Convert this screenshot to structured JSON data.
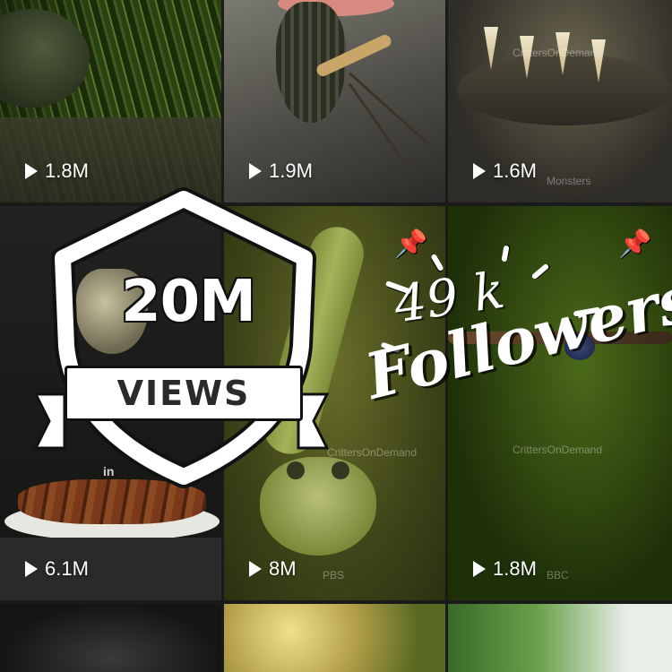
{
  "tiles": [
    {
      "views": "1.8M"
    },
    {
      "views": "1.9M"
    },
    {
      "views": "1.6M",
      "watermark": "Monsters"
    },
    {
      "views": "6.1M",
      "watermark": "in"
    },
    {
      "views": "8M",
      "watermark": "PBS"
    },
    {
      "views": "1.8M",
      "watermark": "CrittersOnDemand",
      "watermark2": "BBC"
    }
  ],
  "tile_watermarks": {
    "t2_top": "CrittersOnDemand",
    "t4_mid": "CrittersOnDemand"
  },
  "badge": {
    "count": "20M",
    "label": "VIEWS"
  },
  "followers": {
    "count": "49 k",
    "label": "Followers"
  },
  "colors": {
    "overlay_text": "#ffffff",
    "outline": "#111111"
  },
  "icons": [
    "play-icon",
    "shield-icon",
    "pushpin-icon"
  ]
}
